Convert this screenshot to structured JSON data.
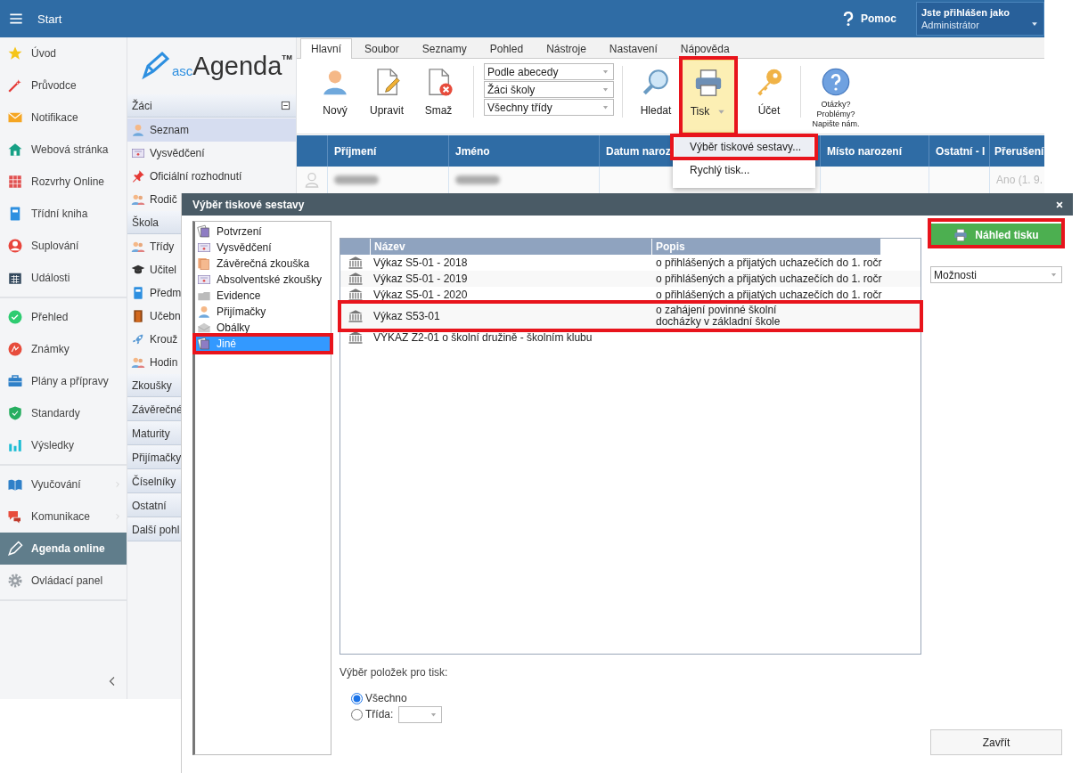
{
  "app_bar": {
    "menu_label": "Start",
    "help_label": "Pomoc",
    "user": {
      "caption": "Jste přihlášen jako",
      "name": "Administrátor"
    }
  },
  "sidebar": {
    "groups": [
      {
        "items": [
          {
            "label": "Úvod",
            "selected": false,
            "has_submenu": false
          },
          {
            "label": "Průvodce",
            "selected": false,
            "has_submenu": false
          },
          {
            "label": "Notifikace",
            "selected": false,
            "has_submenu": false
          },
          {
            "label": "Webová stránka",
            "selected": false,
            "has_submenu": false
          },
          {
            "label": "Rozvrhy Online",
            "selected": false,
            "has_submenu": false
          },
          {
            "label": "Třídní kniha",
            "selected": false,
            "has_submenu": false
          },
          {
            "label": "Suplování",
            "selected": false,
            "has_submenu": false
          },
          {
            "label": "Události",
            "selected": false,
            "has_submenu": false
          }
        ]
      },
      {
        "items": [
          {
            "label": "Přehled",
            "selected": false,
            "has_submenu": false
          },
          {
            "label": "Známky",
            "selected": false,
            "has_submenu": false
          },
          {
            "label": "Plány a přípravy",
            "selected": false,
            "has_submenu": false
          },
          {
            "label": "Standardy",
            "selected": false,
            "has_submenu": false
          },
          {
            "label": "Výsledky",
            "selected": false,
            "has_submenu": false
          }
        ]
      },
      {
        "items": [
          {
            "label": "Vyučování",
            "selected": false,
            "has_submenu": true
          },
          {
            "label": "Komunikace",
            "selected": false,
            "has_submenu": true
          },
          {
            "label": "Agenda online",
            "selected": true,
            "has_submenu": false
          },
          {
            "label": "Ovládací panel",
            "selected": false,
            "has_submenu": false
          }
        ]
      }
    ]
  },
  "nav": {
    "logo": {
      "prefix": "asc",
      "name": "Agenda",
      "mark": "TM"
    },
    "sections": [
      {
        "title": "Žáci",
        "expanded": true,
        "items": [
          {
            "label": "Seznam",
            "selected": true
          },
          {
            "label": "Vysvědčení",
            "selected": false
          },
          {
            "label": "Oficiální rozhodnutí",
            "selected": false
          },
          {
            "label": "Rodič",
            "selected": false
          }
        ]
      },
      {
        "title": "Škola",
        "items": [
          {
            "label": "Třídy",
            "selected": false
          },
          {
            "label": "Učitel",
            "selected": false
          },
          {
            "label": "Předm",
            "selected": false
          },
          {
            "label": "Učebn",
            "selected": false
          },
          {
            "label": "Krouž",
            "selected": false
          },
          {
            "label": "Hodin",
            "selected": false
          }
        ]
      },
      {
        "title": "Zkoušky"
      },
      {
        "title": "Závěrečné"
      },
      {
        "title": "Maturity"
      },
      {
        "title": "Přijímačky"
      },
      {
        "title": "Číselníky"
      },
      {
        "title": "Ostatní"
      },
      {
        "title": "Další pohl"
      }
    ]
  },
  "ribbon": {
    "tabs": [
      {
        "label": "Hlavní",
        "selected": true
      },
      {
        "label": "Soubor",
        "selected": false
      },
      {
        "label": "Seznamy",
        "selected": false
      },
      {
        "label": "Pohled",
        "selected": false
      },
      {
        "label": "Nástroje",
        "selected": false
      },
      {
        "label": "Nastavení",
        "selected": false
      },
      {
        "label": "Nápověda",
        "selected": false
      }
    ],
    "buttons": [
      {
        "label": "Nový",
        "highlighted": false,
        "has_menu": false
      },
      {
        "label": "Upravit",
        "highlighted": false,
        "has_menu": false
      },
      {
        "label": "Smaž",
        "highlighted": false,
        "has_menu": false
      }
    ],
    "filters": [
      "Podle abecedy",
      "Žáci školy",
      "Všechny třídy"
    ],
    "tools": [
      {
        "label": "Hledat",
        "highlighted": false,
        "has_menu": false
      },
      {
        "label": "Tisk",
        "highlighted": true,
        "has_menu": true
      },
      {
        "label": "Účet",
        "highlighted": false,
        "has_menu": false
      }
    ],
    "help_text": "Otázky?\nProblémy?\nNapište nám."
  },
  "table": {
    "columns": [
      "Příjmení",
      "Jméno",
      "Datum naroz",
      "Místo narození",
      "Ostatní - I",
      "Přerušení"
    ],
    "rows": [
      {
        "cells": [
          {
            "kind": "redacted"
          },
          {
            "kind": "redacted"
          },
          {
            "kind": "empty"
          },
          {
            "kind": "empty"
          },
          {
            "kind": "empty"
          },
          {
            "kind": "text",
            "text": "Ano (1. 9."
          }
        ]
      }
    ]
  },
  "print_menu": {
    "items": [
      {
        "label": "Výběr tiskové sestavy...",
        "selected": true,
        "highlighted": true
      },
      {
        "label": "Rychlý tisk...",
        "selected": false,
        "highlighted": false
      }
    ]
  },
  "dialog": {
    "title": "Výběr tiskové sestavy",
    "categories": [
      {
        "label": "Potvrzení",
        "selected": false,
        "highlighted": false
      },
      {
        "label": "Vysvědčení",
        "selected": false,
        "highlighted": false
      },
      {
        "label": "Závěrečná zkouška",
        "selected": false,
        "highlighted": false
      },
      {
        "label": "Absolventské zkoušky",
        "selected": false,
        "highlighted": false
      },
      {
        "label": "Evidence",
        "selected": false,
        "highlighted": false
      },
      {
        "label": "Přijímačky",
        "selected": false,
        "highlighted": false
      },
      {
        "label": "Obálky",
        "selected": false,
        "highlighted": false
      },
      {
        "label": "Jiné",
        "selected": true,
        "highlighted": true
      }
    ],
    "reports": {
      "columns": [
        "Název",
        "Popis"
      ],
      "rows": [
        {
          "name": "Výkaz S5-01 - 2018",
          "description": "o přihlášených a přijatých uchazečích do 1. ročr",
          "highlighted": false
        },
        {
          "name": "Výkaz S5-01 - 2019",
          "description": "o přihlášených a přijatých uchazečích do 1. ročr",
          "highlighted": false
        },
        {
          "name": "Výkaz S5-01 - 2020",
          "description": "o přihlášených a přijatých uchazečích do 1. ročr",
          "highlighted": false
        },
        {
          "name": "Výkaz S53-01",
          "description": "o zahájení povinné školní\ndocházky v základní škole",
          "highlighted": true
        },
        {
          "name": "VÝKAZ Z2-01 o školní družině - školním klubu",
          "highlighted": false
        }
      ]
    },
    "preview_button": {
      "label": "Náhled tisku",
      "highlighted": true
    },
    "options_select": "Možnosti",
    "scope": {
      "label": "Výběr položek pro tisk:",
      "options": [
        {
          "label": "Všechno",
          "selected": true,
          "kind": "plain"
        },
        {
          "label": "Třída:",
          "selected": false,
          "kind": "select"
        }
      ]
    },
    "close_button": "Zavřít"
  }
}
